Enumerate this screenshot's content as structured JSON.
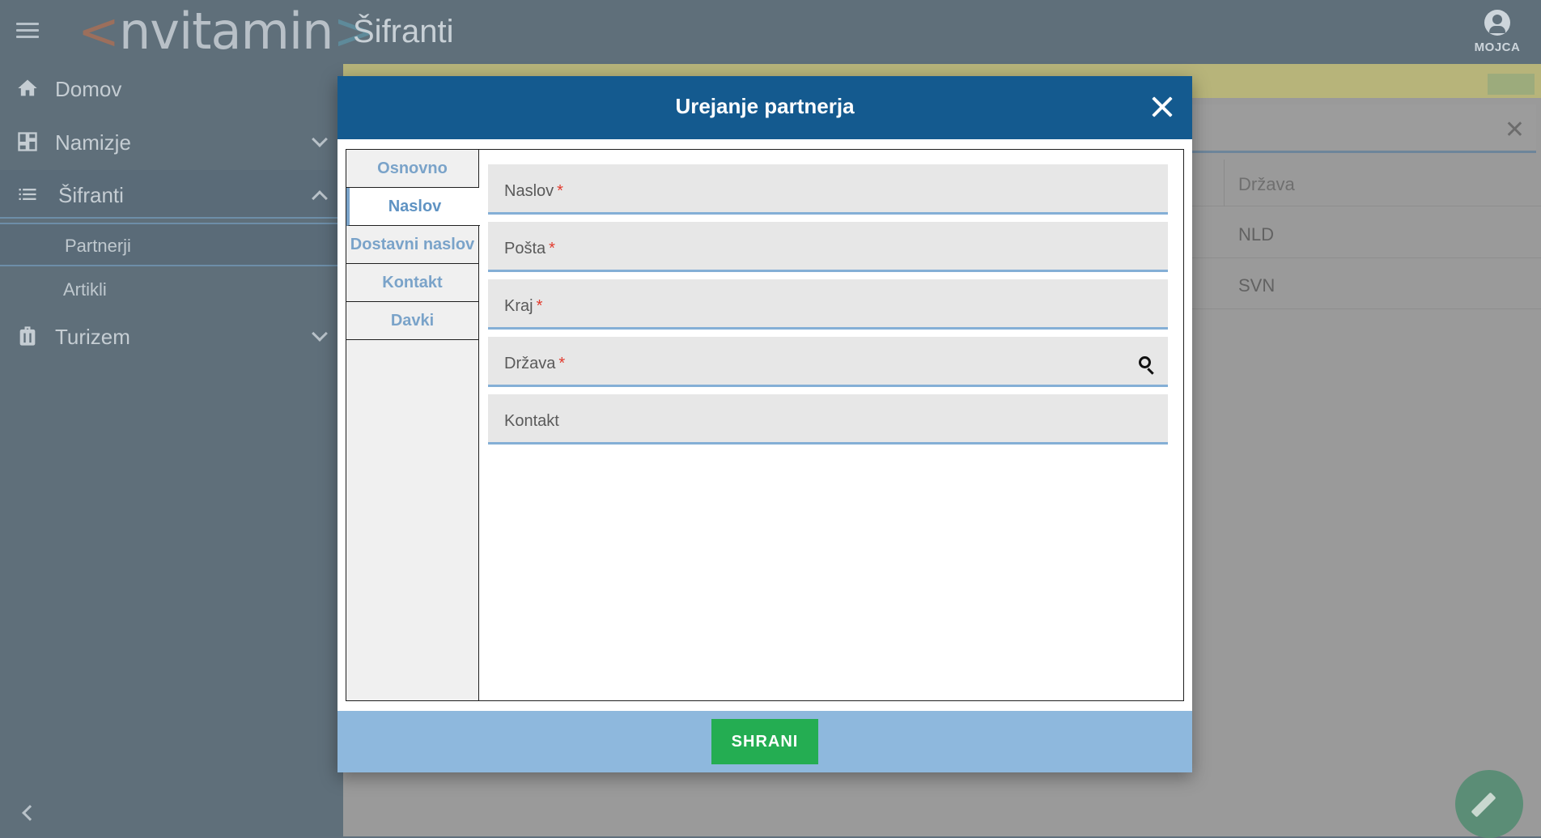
{
  "app": {
    "logo_left": "<",
    "logo_text": "nvitamin",
    "logo_right": ">",
    "page_title": "Šifranti",
    "user_name": "MOJCA"
  },
  "sidebar": {
    "items": [
      {
        "label": "Domov",
        "icon": "home-icon"
      },
      {
        "label": "Namizje",
        "icon": "dashboard-icon"
      },
      {
        "label": "Šifranti",
        "icon": "list-icon"
      },
      {
        "label": "Turizem",
        "icon": "luggage-icon"
      }
    ],
    "subitems": [
      {
        "label": "Partnerji"
      },
      {
        "label": "Artikli"
      }
    ]
  },
  "grid": {
    "column_header": "Država",
    "rows": [
      {
        "drzava": "NLD"
      },
      {
        "drzava": "SVN"
      }
    ]
  },
  "modal": {
    "title": "Urejanje partnerja",
    "tabs": [
      {
        "label": "Osnovno"
      },
      {
        "label": "Naslov"
      },
      {
        "label": "Dostavni naslov"
      },
      {
        "label": "Kontakt"
      },
      {
        "label": "Davki"
      }
    ],
    "active_tab": "Naslov",
    "fields": [
      {
        "label": "Naslov",
        "required": "*",
        "value": ""
      },
      {
        "label": "Pošta",
        "required": "*",
        "value": ""
      },
      {
        "label": "Kraj",
        "required": "*",
        "value": ""
      },
      {
        "label": "Država",
        "required": "*",
        "value": ""
      },
      {
        "label": "Kontakt",
        "required": "",
        "value": ""
      }
    ],
    "save_label": "SHRANI"
  },
  "colors": {
    "header": "#145a8f",
    "save": "#24ad52",
    "footer": "#8eb8dd",
    "required": "#e23b2e"
  }
}
